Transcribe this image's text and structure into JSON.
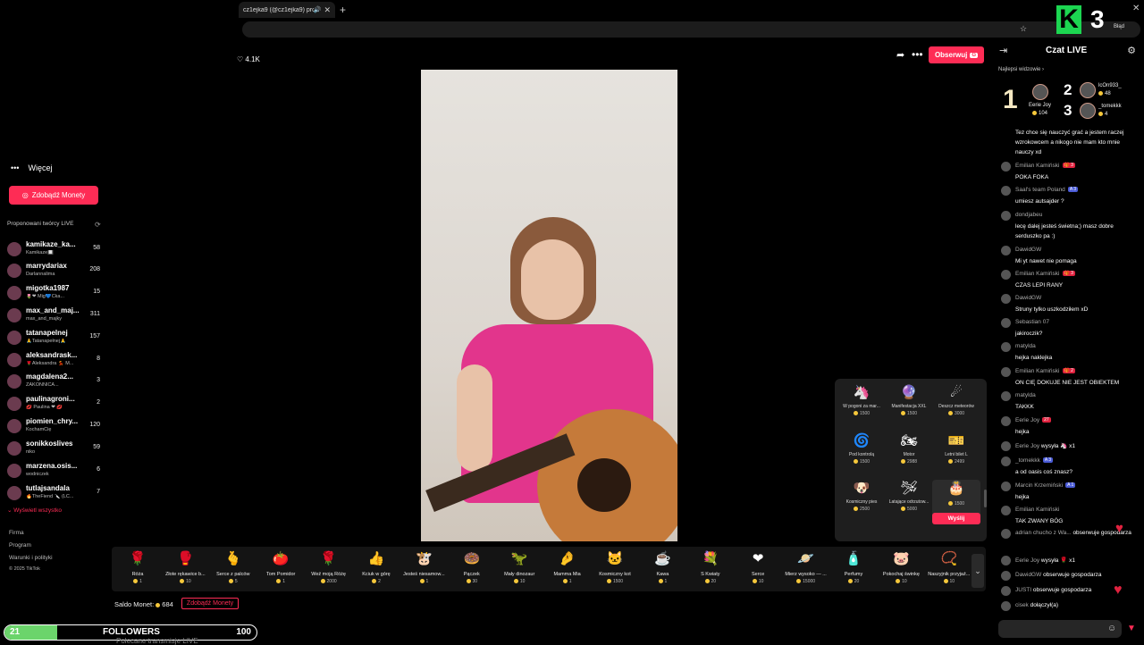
{
  "browser": {
    "tab_title": "cz1ejka9 (@cz1ejka9) prow...",
    "tab_close": "✕",
    "new_tab": "+",
    "error_label": "Błąd",
    "minimize": "─",
    "restore": "☐",
    "close": "✕",
    "badge_letter": "K",
    "badge_number": "3"
  },
  "sidebar": {
    "more_label": "Więcej",
    "coins_button": "Zdobądź Monety",
    "suggested_title": "Proponowani twórcy LIVE",
    "creators": [
      {
        "name": "kamikaze_ka...",
        "sub": "Kamikaze🔲",
        "count": "58"
      },
      {
        "name": "marrydariax",
        "sub": "Darlannalima",
        "count": "208"
      },
      {
        "name": "migotka1987",
        "sub": "🌷❤ Mig💙Cka...",
        "count": "15"
      },
      {
        "name": "max_and_maj...",
        "sub": "max_and_majky",
        "count": "311"
      },
      {
        "name": "tatanapelnej",
        "sub": "🙏Tatanapełnej🙏",
        "count": "157"
      },
      {
        "name": "aleksandrask...",
        "sub": "🌹Aleksandra 💃 M...",
        "count": "8"
      },
      {
        "name": "magdalena2...",
        "sub": "ZAKONNICA...",
        "count": "3"
      },
      {
        "name": "paulinagroni...",
        "sub": "💋 Paulina ❤ 💋",
        "count": "2"
      },
      {
        "name": "piomien_chry...",
        "sub": "KochamCię",
        "count": "120"
      },
      {
        "name": "sonikkoslives",
        "sub": "niko",
        "count": "59"
      },
      {
        "name": "marzena.osis...",
        "sub": "wodniczek",
        "count": "6"
      },
      {
        "name": "tutlajsandala",
        "sub": "🔥TheFiend 🔪 (LC...",
        "count": "7"
      }
    ],
    "show_all": "Wyświetl wszystko",
    "footer": [
      "Firma",
      "Program",
      "Warunki i polityki",
      "© 2025 TikTok"
    ]
  },
  "stream": {
    "likes": "4.1K",
    "follow_label": "Obserwuj",
    "follow_icon": "G"
  },
  "gift_popup": {
    "gifts": [
      {
        "name": "W pogoni za mar...",
        "price": "1500",
        "icon": "🦄"
      },
      {
        "name": "Manifestacja XXL",
        "price": "1500",
        "icon": "🔮"
      },
      {
        "name": "Deszcz meteorów",
        "price": "3000",
        "icon": "☄"
      },
      {
        "name": "Pod kontrolą",
        "price": "1500",
        "icon": "🌀"
      },
      {
        "name": "Motor",
        "price": "2988",
        "icon": "🏍"
      },
      {
        "name": "Letni bilet L",
        "price": "2499",
        "icon": "🎫"
      },
      {
        "name": "Kosmiczny pies",
        "price": "2500",
        "icon": "🐶"
      },
      {
        "name": "Latające odrzutow...",
        "price": "5000",
        "icon": "🛩"
      },
      {
        "name": "",
        "price": "1500",
        "icon": "🎂"
      }
    ],
    "send_label": "Wyślij"
  },
  "gift_bar": {
    "gifts": [
      {
        "name": "Róża",
        "price": "1",
        "icon": "🌹"
      },
      {
        "name": "Złote rękawice b...",
        "price": "10",
        "icon": "🥊"
      },
      {
        "name": "Serce z palców",
        "price": "5",
        "icon": "🫰"
      },
      {
        "name": "Tom Pomidor",
        "price": "1",
        "icon": "🍅"
      },
      {
        "name": "Weź moją Różę",
        "price": "2000",
        "icon": "🌹"
      },
      {
        "name": "Kciuk w górę",
        "price": "2",
        "icon": "👍"
      },
      {
        "name": "Jesteś niesamow...",
        "price": "1",
        "icon": "🐮"
      },
      {
        "name": "Pączek",
        "price": "30",
        "icon": "🍩"
      },
      {
        "name": "Mały dinozaur",
        "price": "10",
        "icon": "🦖"
      },
      {
        "name": "Mamma Mia",
        "price": "1",
        "icon": "🤌"
      },
      {
        "name": "Kosmiczny kot",
        "price": "1500",
        "icon": "🐱"
      },
      {
        "name": "Kawa",
        "price": "1",
        "icon": "☕"
      },
      {
        "name": "S Kwiaty",
        "price": "20",
        "icon": "💐"
      },
      {
        "name": "Serce",
        "price": "10",
        "icon": "❤"
      },
      {
        "name": "Mierz wysoko — ...",
        "price": "15000",
        "icon": "🪐"
      },
      {
        "name": "Perfumy",
        "price": "20",
        "icon": "🧴"
      },
      {
        "name": "Pokochaj świnkę",
        "price": "10",
        "icon": "🐷"
      },
      {
        "name": "Naszyjnik przyjaź...",
        "price": "10",
        "icon": "📿"
      }
    ],
    "more_icon": "⌄",
    "saldo_label": "Saldo Monet:",
    "saldo_value": "684",
    "get_coins": "Zdobądź Monety"
  },
  "followers_bar": {
    "left": "21",
    "label": "FOLLOWERS",
    "right": "100",
    "progress": 0.21
  },
  "bottom_text": "Polecane transmisje LIVE",
  "chat": {
    "title": "Czat LIVE",
    "top_viewers_label": "Najlepsi widzowie",
    "top_viewers": [
      {
        "rank": "1",
        "name": "Eerie Joy",
        "score": "104"
      },
      {
        "rank": "2",
        "name": "lcOn933_",
        "score": "48"
      },
      {
        "rank": "3",
        "name": "_tomekkk",
        "score": "4"
      }
    ],
    "messages": [
      {
        "user": "",
        "badge": "",
        "text": "Tez chce się nauczyć grać a jestem raczej wzrokowcem a nikogo nie mam kto mnie nauczy xd"
      },
      {
        "user": "Emilian Kamiński",
        "badge": "🎁 3",
        "text": "POKA FOKA"
      },
      {
        "user": "Saal's team Poland",
        "badge": "A 3",
        "text": "umiesz autsajder ?"
      },
      {
        "user": "dondjabeu",
        "badge": "",
        "text": "lecę dalej jesteś świetna;) masz dobre serduszko pa :)"
      },
      {
        "user": "DawidGW",
        "badge": "",
        "text": "Mi yt nawet nie pomaga"
      },
      {
        "user": "Emilian Kamiński",
        "badge": "🎁 3",
        "text": "CZAS LEPI RANY"
      },
      {
        "user": "DawidGW",
        "badge": "",
        "text": "Struny tylko uszkodziłem xD"
      },
      {
        "user": "Sebastian 07",
        "badge": "",
        "text": "jakiroczik?"
      },
      {
        "user": "matylda",
        "badge": "",
        "text": "hejka naklejka"
      },
      {
        "user": "Emilian Kamiński",
        "badge": "🎁 2",
        "text": "ON CIĘ DOKUJE NIE JEST OBIEKTEM"
      },
      {
        "user": "matylda",
        "badge": "",
        "text": "TAKKK"
      },
      {
        "user": "Eerie Joy",
        "badge": "27",
        "text": "hejka"
      },
      {
        "user": "Eerie Joy",
        "badge": "",
        "text": "wysyła 🦄 x1"
      },
      {
        "user": "_tomekkk",
        "badge": "A 3",
        "text": "a od oasis coś znasz?"
      },
      {
        "user": "Marcin Krzemiński",
        "badge": "A 1",
        "text": "hejka"
      },
      {
        "user": "Emilian Kamiński",
        "badge": "",
        "text": "TAK ZWANY BÓG"
      },
      {
        "user": "adrian chucho z Wa...",
        "badge": "",
        "text": "obserwuje gospodarza"
      },
      {
        "user": "Eerie Joy",
        "badge": "",
        "text": "wysyła 🌹 x1"
      },
      {
        "user": "DawidGW",
        "badge": "",
        "text": "obserwuje gospodarza"
      },
      {
        "user": "JUSTI",
        "badge": "",
        "text": "obserwuje gospodarza"
      },
      {
        "user": "cisek",
        "badge": "",
        "text": "dołączył(a)"
      }
    ]
  }
}
